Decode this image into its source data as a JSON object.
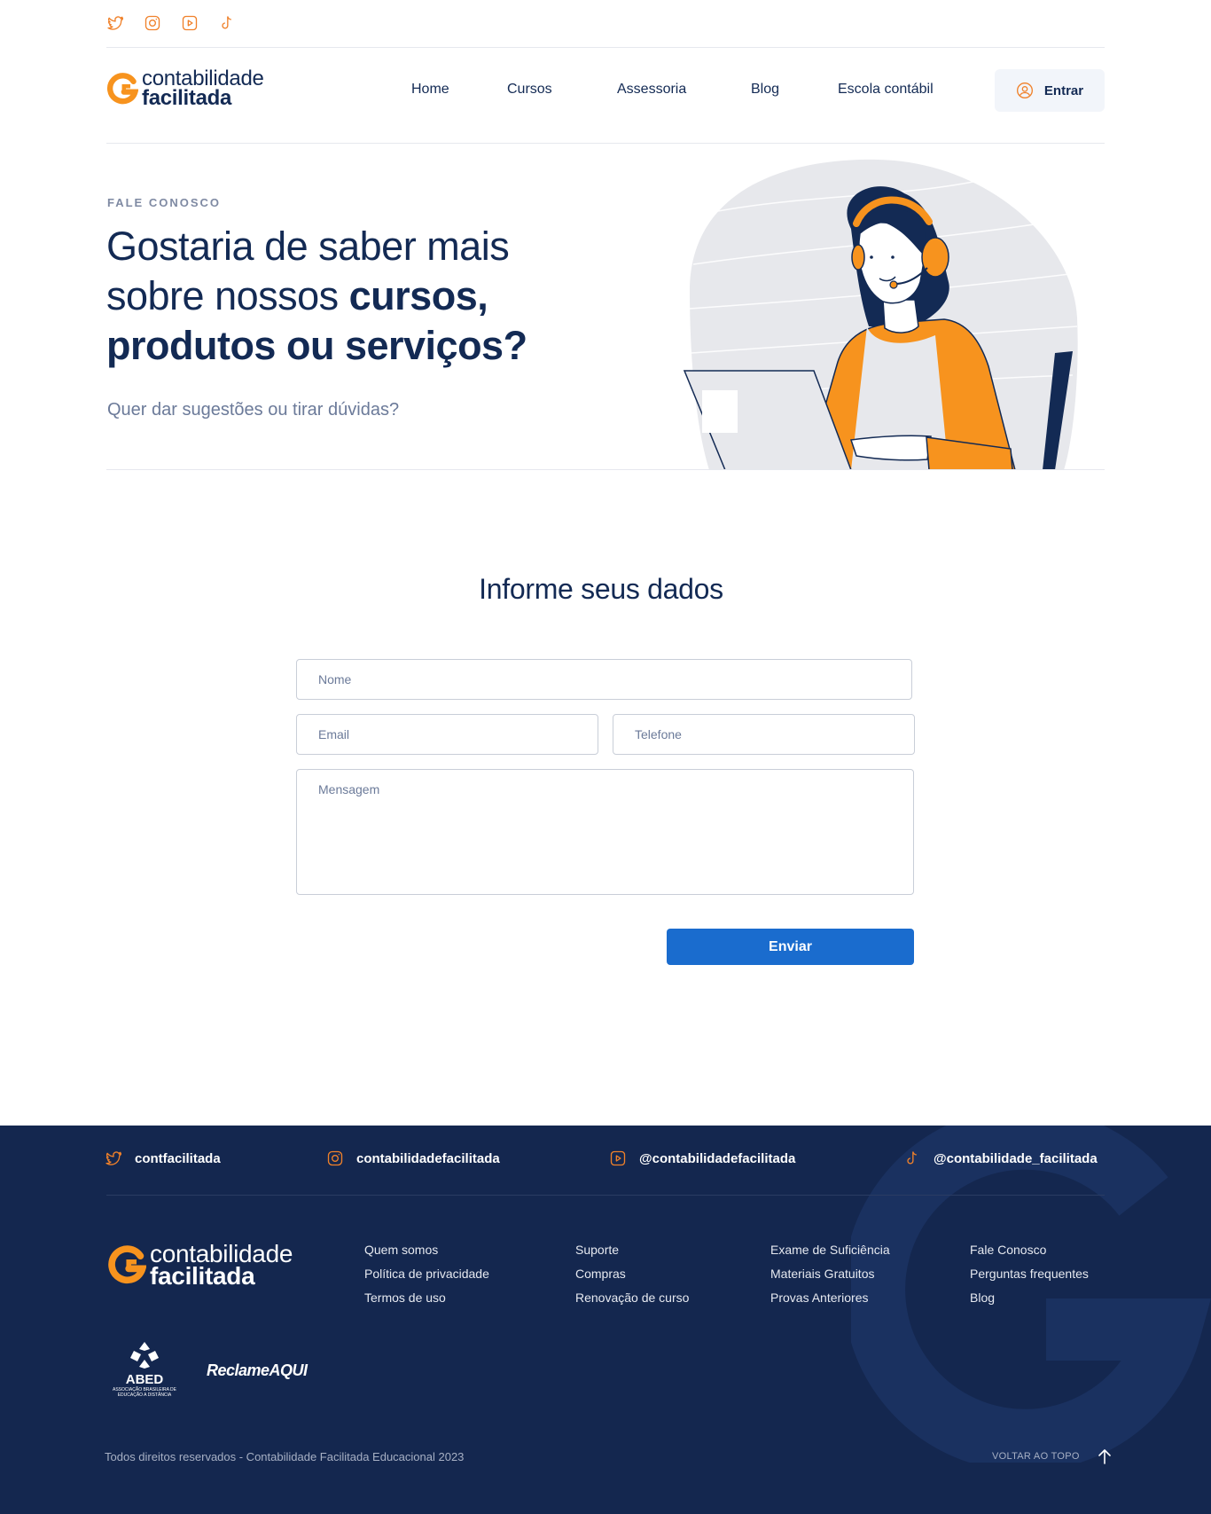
{
  "top_social": {
    "icons": [
      "twitter-icon",
      "instagram-icon",
      "youtube-icon",
      "tiktok-icon"
    ]
  },
  "brand": {
    "line1": "contabilidade",
    "line2": "facilitada"
  },
  "nav": {
    "items": [
      "Home",
      "Cursos",
      "Assessoria",
      "Blog",
      "Escola contábil"
    ],
    "login_label": "Entrar"
  },
  "hero": {
    "eyebrow": "FALE CONOSCO",
    "title_line1": "Gostaria de saber mais",
    "title_line2_regular": "sobre nossos ",
    "title_line2_bold": "cursos,",
    "title_line3_bold": "produtos ou serviços?",
    "subtitle": "Quer dar sugestões ou tirar dúvidas?"
  },
  "form": {
    "title": "Informe seus dados",
    "name_placeholder": "Nome",
    "email_placeholder": "Email",
    "phone_placeholder": "Telefone",
    "message_placeholder": "Mensagem",
    "submit_label": "Enviar"
  },
  "footer": {
    "social": [
      {
        "icon": "twitter-icon",
        "handle": "contfacilitada"
      },
      {
        "icon": "instagram-icon",
        "handle": "contabilidadefacilitada"
      },
      {
        "icon": "youtube-icon",
        "handle": "@contabilidadefacilitada"
      },
      {
        "icon": "tiktok-icon",
        "handle": "@contabilidade_facilitada"
      }
    ],
    "columns": [
      [
        "Quem somos",
        "Política de privacidade",
        "Termos de uso"
      ],
      [
        "Suporte",
        "Compras",
        "Renovação de curso"
      ],
      [
        "Exame de Suficiência",
        "Materiais Gratuitos",
        "Provas Anteriores"
      ],
      [
        "Fale Conosco",
        "Perguntas frequentes",
        "Blog"
      ]
    ],
    "abed_name": "ABED",
    "abed_desc": "ASSOCIAÇÃO BRASILEIRA DE EDUCAÇÃO A DISTÂNCIA",
    "reclame_aqui": "ReclameAQUI",
    "copyright": "Todos direitos reservados - Contabilidade Facilitada Educacional 2023",
    "back_to_top": "VOLTAR AO TOPO"
  },
  "colors": {
    "brand_navy": "#132a54",
    "brand_orange": "#f7931e",
    "button_blue": "#1a6cce",
    "footer_bg": "#14274f"
  }
}
